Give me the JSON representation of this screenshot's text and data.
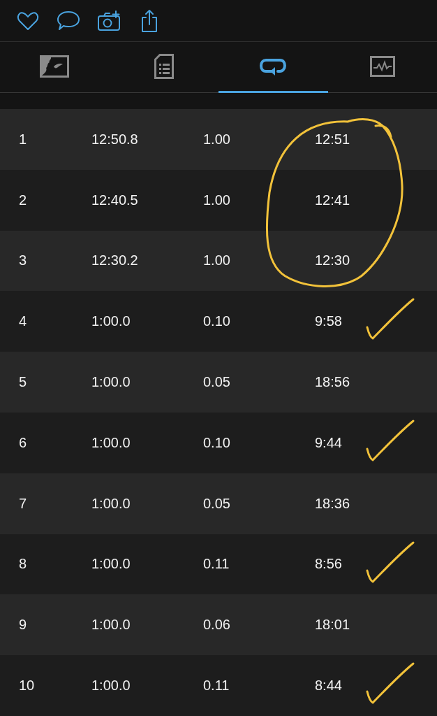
{
  "actions": [
    {
      "kind": "heart"
    },
    {
      "kind": "comment"
    },
    {
      "kind": "camera"
    },
    {
      "kind": "share"
    }
  ],
  "tabs": [
    {
      "kind": "map",
      "selected": false
    },
    {
      "kind": "details",
      "selected": false
    },
    {
      "kind": "laps",
      "selected": true
    },
    {
      "kind": "chart",
      "selected": false
    }
  ],
  "laps": [
    {
      "lap": "1",
      "time": "12:50.8",
      "distance": "1.00",
      "pace": "12:51",
      "circled": true,
      "ticked": false
    },
    {
      "lap": "2",
      "time": "12:40.5",
      "distance": "1.00",
      "pace": "12:41",
      "circled": true,
      "ticked": false
    },
    {
      "lap": "3",
      "time": "12:30.2",
      "distance": "1.00",
      "pace": "12:30",
      "circled": true,
      "ticked": false
    },
    {
      "lap": "4",
      "time": "1:00.0",
      "distance": "0.10",
      "pace": "9:58",
      "circled": false,
      "ticked": true
    },
    {
      "lap": "5",
      "time": "1:00.0",
      "distance": "0.05",
      "pace": "18:56",
      "circled": false,
      "ticked": false
    },
    {
      "lap": "6",
      "time": "1:00.0",
      "distance": "0.10",
      "pace": "9:44",
      "circled": false,
      "ticked": true
    },
    {
      "lap": "7",
      "time": "1:00.0",
      "distance": "0.05",
      "pace": "18:36",
      "circled": false,
      "ticked": false
    },
    {
      "lap": "8",
      "time": "1:00.0",
      "distance": "0.11",
      "pace": "8:56",
      "circled": false,
      "ticked": true
    },
    {
      "lap": "9",
      "time": "1:00.0",
      "distance": "0.06",
      "pace": "18:01",
      "circled": false,
      "ticked": false
    },
    {
      "lap": "10",
      "time": "1:00.0",
      "distance": "0.11",
      "pace": "8:44",
      "circled": false,
      "ticked": true
    }
  ]
}
